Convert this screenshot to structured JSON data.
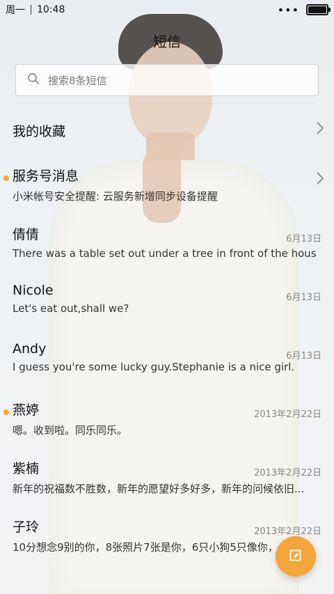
{
  "status": {
    "weekday": "周一",
    "time": "10:48",
    "more": "•••"
  },
  "title": "短信",
  "search": {
    "placeholder": "搜索8条短信"
  },
  "favorites": {
    "label": "我的收藏"
  },
  "conversations": [
    {
      "name": "服务号消息",
      "preview": "小米帐号安全提醒: 云服务新增同步设备提醒",
      "date": "",
      "unread": true,
      "chevron": true
    },
    {
      "name": "倩倩",
      "preview": "There was a table set out under a tree in front of the hous",
      "date": "6月13日",
      "unread": false,
      "chevron": false
    },
    {
      "name": "Nicole",
      "preview": "Let's eat out,shall we?",
      "date": "6月13日",
      "unread": false,
      "chevron": false
    },
    {
      "name": "Andy",
      "preview": "I guess you're some lucky guy.Stephanie is a nice girl.",
      "date": "6月13日",
      "unread": false,
      "chevron": false
    },
    {
      "name": "燕婷",
      "preview": "嗯。收到啦。同乐同乐。",
      "date": "2013年2月22日",
      "unread": true,
      "chevron": false
    },
    {
      "name": "紫楠",
      "preview": "新年的祝福数不胜数，新年的愿望好多好多，新年的问候依旧...",
      "date": "2013年2月22日",
      "unread": false,
      "chevron": false
    },
    {
      "name": "子玲",
      "preview": "10分想念9别的你，8张照片7张是你，6只小狗5只像你，",
      "date": "2013年2月22日",
      "unread": false,
      "chevron": false
    }
  ],
  "colors": {
    "accent": "#f4a53b",
    "unread": "#f5a623"
  },
  "icons": {
    "search": "search-icon",
    "compose": "compose-icon",
    "chevron": "chevron-right-icon"
  }
}
